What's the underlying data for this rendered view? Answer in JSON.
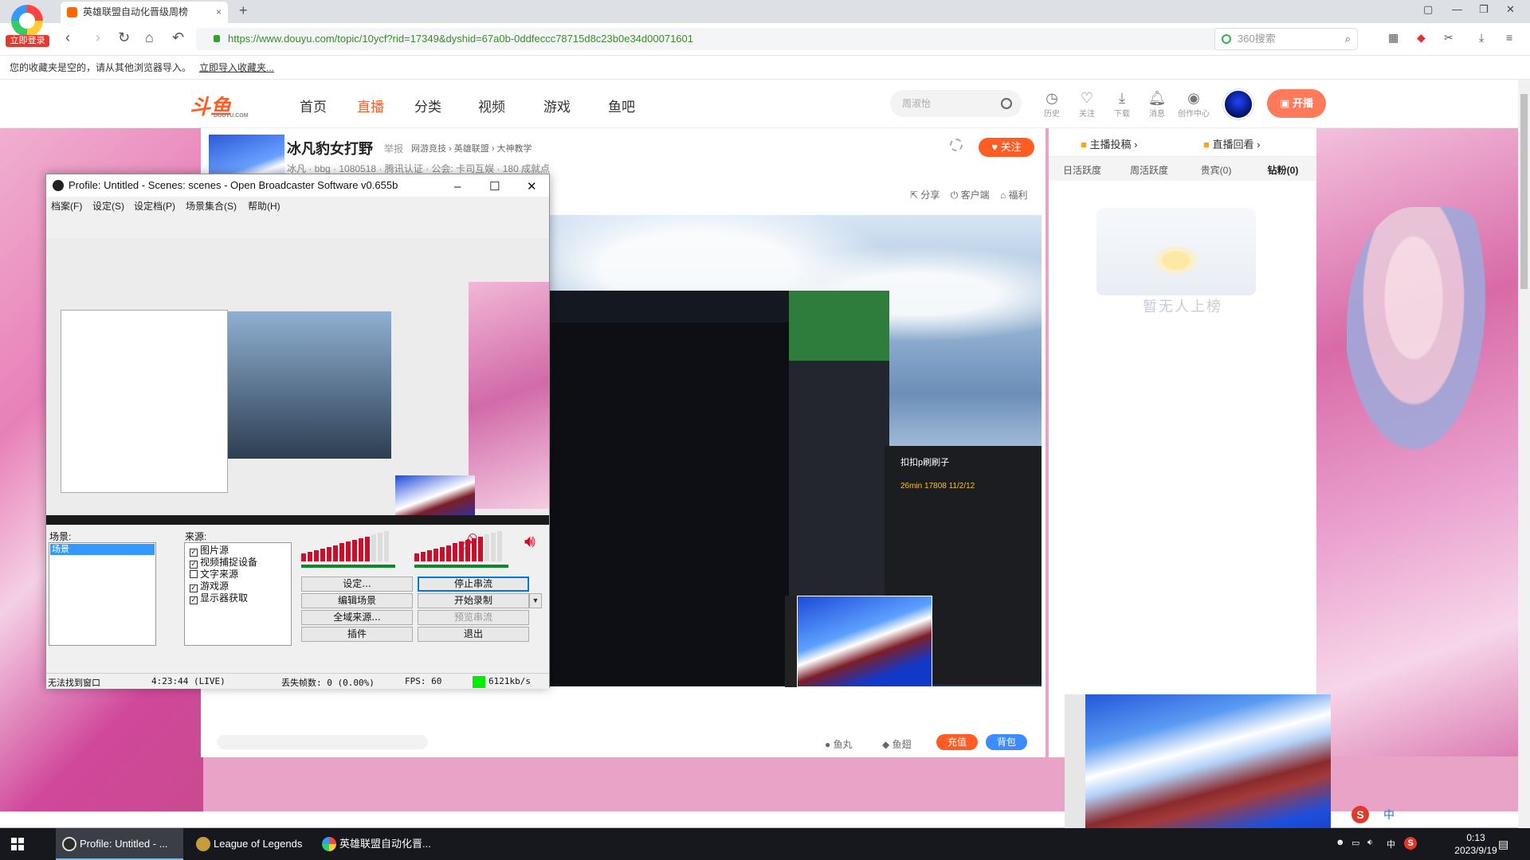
{
  "browser": {
    "login_badge": "立即登录",
    "tab_title": "英雄联盟自动化晋级周榜",
    "tab_close": "×",
    "new_tab": "+",
    "url": "https://www.douyu.com/topic/10ycf?rid=17349&dyshid=67a0b-0ddfeccc78715d8c23b0e34d00071601",
    "search_placeholder": "360搜索",
    "favbar_text": "您的收藏夹是空的，请从其他浏览器导入。",
    "favbar_link": "立即导入收藏夹..."
  },
  "site": {
    "logo": "斗鱼",
    "logo_sub": "DOUYU.COM",
    "nav": [
      "首页",
      "直播",
      "分类",
      "视频",
      "游戏",
      "鱼吧"
    ],
    "search_placeholder": "周淑怡",
    "header_icons": [
      "历史",
      "关注",
      "下载",
      "消息",
      "创作中心"
    ],
    "start_live": "开播"
  },
  "room": {
    "title": "冰凡豹女打野",
    "report": "举报",
    "crumbs": "网游竞技 › 英雄联盟 › 大神教学",
    "meta": "冰凡 · bbg · 1080518 · 腾讯认证 · 公会: 卡司互娱 · 180 成就点",
    "follow": "关注",
    "actions": [
      "分享",
      "客户端",
      "福利"
    ],
    "video_popup_title": "扣扣p刷刷子",
    "video_popup_stats": "26min   17808   11/2/12",
    "bottom": {
      "yuwan": "鱼丸",
      "yuchi": "鱼翅",
      "recharge": "充值",
      "bag": "背包"
    }
  },
  "rank": {
    "submit": "主播投稿 ›",
    "replay": "直播回看 ›",
    "tabs": [
      "日活跃度",
      "周活跃度",
      "贵宾(0)",
      "钻粉(0)"
    ],
    "empty": "暂无人上榜"
  },
  "obs": {
    "title": "Profile: Untitled - Scenes: scenes - Open Broadcaster Software v0.655b",
    "menu": [
      "档案(F)",
      "设定(S)",
      "设定档(P)",
      "场景集合(S)",
      "帮助(H)"
    ],
    "scenes_label": "场景:",
    "scene_selected": "场景",
    "sources_label": "来源:",
    "sources": [
      {
        "label": "图片源",
        "checked": true
      },
      {
        "label": "视频捕捉设备",
        "checked": true
      },
      {
        "label": "文字来源",
        "checked": false
      },
      {
        "label": "游戏源",
        "checked": true
      },
      {
        "label": "显示器获取",
        "checked": true
      }
    ],
    "buttons": [
      "设定...",
      "停止串流",
      "编辑场景",
      "开始录制",
      "全域来源...",
      "预览串流",
      "插件",
      "退出"
    ],
    "status_window": "无法找到窗口",
    "status_time": "4:23:44 (LIVE)",
    "status_dropped": "丢失帧数: 0 (0.00%)",
    "status_fps": "FPS: 60",
    "status_kbps": "6121kb/s",
    "mic_level": 0.75,
    "desktop_level": 0.8
  },
  "taskbar": {
    "items": [
      "Profile: Untitled - ...",
      "League of Legends",
      "英雄联盟自动化晋..."
    ],
    "ime": "中",
    "time": "0:13",
    "date": "2023/9/19"
  }
}
